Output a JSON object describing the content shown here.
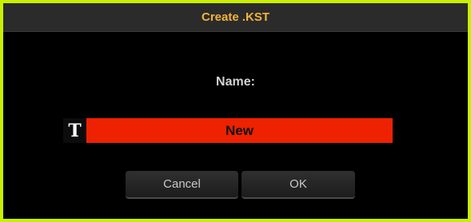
{
  "dialog": {
    "title": "Create .KST",
    "name_label": "Name:",
    "text_icon_glyph": "T",
    "name_value": "New",
    "cancel_label": "Cancel",
    "ok_label": "OK"
  },
  "colors": {
    "title_text": "#f2b33a",
    "field_background": "#ee2100",
    "frame_border": "#c8f000"
  },
  "icons": {
    "text_entry": "text-icon"
  }
}
